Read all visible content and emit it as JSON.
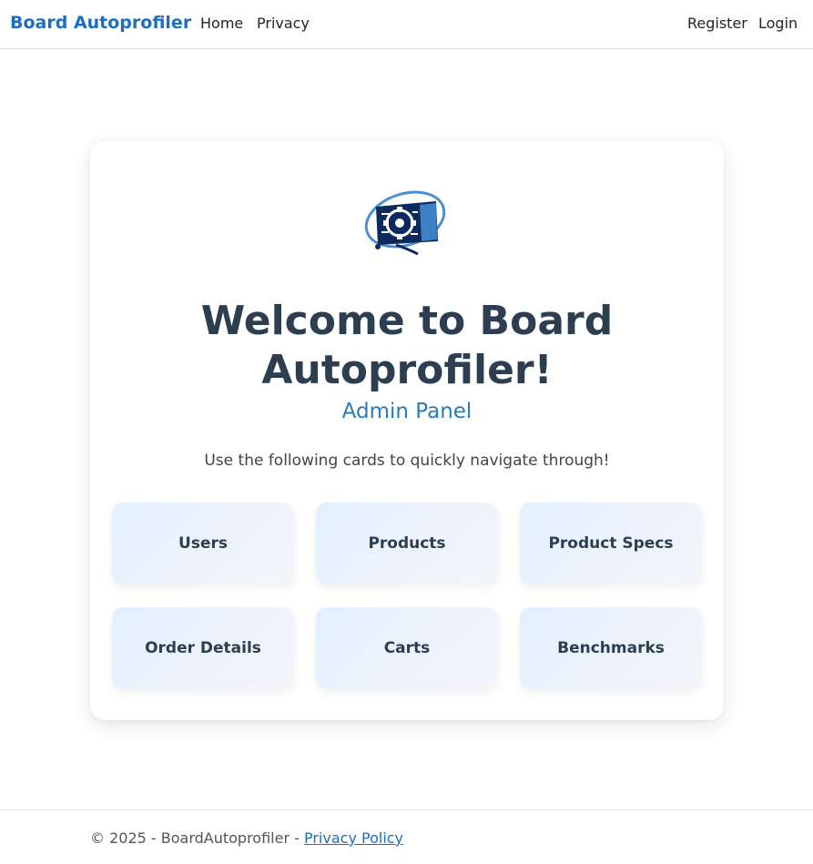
{
  "navbar": {
    "brand": "Board Autoprofiler",
    "links": [
      "Home",
      "Privacy"
    ],
    "right_links": [
      "Register",
      "Login"
    ]
  },
  "main": {
    "title": "Welcome to Board Autoprofiler!",
    "subtitle": "Admin Panel",
    "intro": "Use the following cards to quickly navigate through!",
    "cards": [
      "Users",
      "Products",
      "Product Specs",
      "Order Details",
      "Carts",
      "Benchmarks"
    ]
  },
  "footer": {
    "text": "© 2025 - BoardAutoprofiler - ",
    "link": "Privacy Policy"
  },
  "colors": {
    "brand": "#1b6ec2",
    "title": "#2c3e50",
    "subtitle": "#2b7bb9",
    "logo_dark": "#0d2a5c",
    "logo_light": "#4a8fd0"
  },
  "icons": {
    "logo": "gear-chip-monitor-icon"
  }
}
